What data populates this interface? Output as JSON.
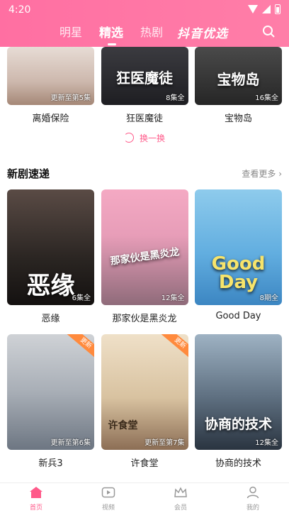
{
  "status_bar": {
    "time": "4:20"
  },
  "header": {
    "tabs": [
      {
        "label": "明星"
      },
      {
        "label": "精选"
      },
      {
        "label": "热剧"
      }
    ],
    "brand": "抖音优选"
  },
  "top_row": [
    {
      "title": "离婚保险",
      "episodes": "更新至第5集"
    },
    {
      "title": "狂医魔徒",
      "episodes": "8集全",
      "poster_text": "狂医魔徒"
    },
    {
      "title": "宝物岛",
      "episodes": "16集全",
      "poster_text": "宝物岛"
    }
  ],
  "refresh_label": "换一换",
  "new_drama": {
    "title": "新剧速递",
    "see_more": "查看更多",
    "row1": [
      {
        "title": "恶缘",
        "episodes": "6集全",
        "poster_text": "恶缘"
      },
      {
        "title": "那家伙是黑炎龙",
        "episodes": "12集全",
        "poster_text": "那家伙是黑炎龙"
      },
      {
        "title": "Good Day",
        "episodes": "8期全",
        "poster_text": "Good Day"
      }
    ],
    "row2": [
      {
        "title": "新兵3",
        "episodes": "更新至第6集",
        "ribbon": "更新"
      },
      {
        "title": "许食堂",
        "episodes": "更新至第7集",
        "ribbon": "更新",
        "poster_text": "许食堂"
      },
      {
        "title": "协商的技术",
        "episodes": "12集全",
        "poster_text": "协商的技术"
      }
    ]
  },
  "bottom_nav": [
    {
      "label": "首页"
    },
    {
      "label": "视频"
    },
    {
      "label": "会员"
    },
    {
      "label": "我的"
    }
  ],
  "colors": {
    "accent": "#ff5a8a",
    "header": "#ff7aa6",
    "ribbon": "#ff8a3d"
  }
}
